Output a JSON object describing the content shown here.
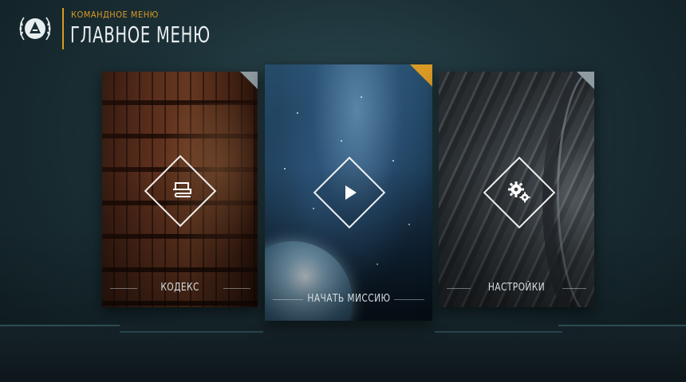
{
  "header": {
    "subtitle": "КОМАНДНОЕ МЕНЮ",
    "title": "ГЛАВНОЕ МЕНЮ",
    "logo_icon": "laurel-emblem-icon"
  },
  "cards": {
    "codex": {
      "label": "КОДЕКС",
      "icon": "book-icon"
    },
    "mission": {
      "label": "НАЧАТЬ МИССИЮ",
      "icon": "play-icon"
    },
    "settings": {
      "label": "НАСТРОЙКИ",
      "icon": "gears-icon"
    }
  },
  "colors": {
    "accent": "#d99a25",
    "background": "#1b3036",
    "text": "#e9eef0"
  }
}
